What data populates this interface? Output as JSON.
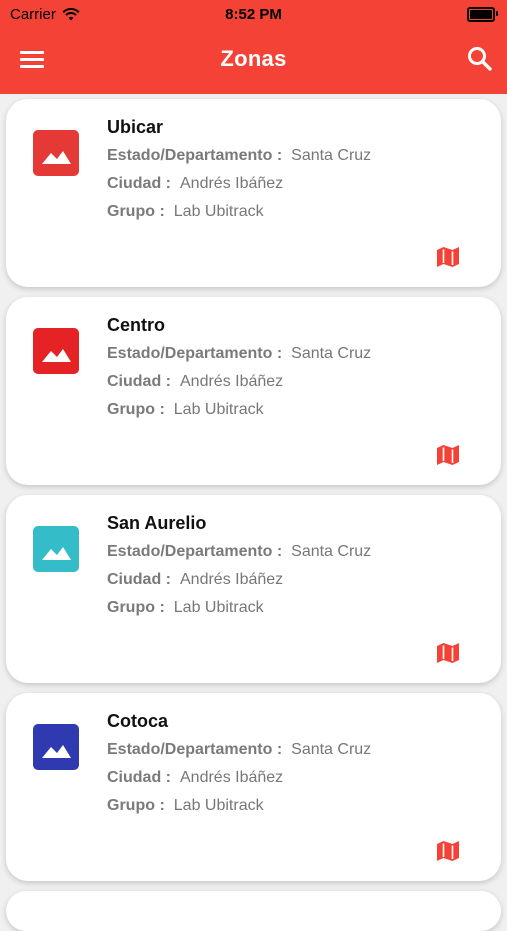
{
  "status_bar": {
    "carrier": "Carrier",
    "time": "8:52 PM"
  },
  "appbar": {
    "title": "Zonas",
    "menu_icon": "menu-icon",
    "search_icon": "search-icon"
  },
  "labels": {
    "estado": "Estado/Departamento :",
    "ciudad": "Ciudad :",
    "grupo": "Grupo :"
  },
  "zones": [
    {
      "name": "Ubicar",
      "estado": "Santa Cruz",
      "ciudad": "Andrés Ibáñez",
      "grupo": "Lab Ubitrack",
      "color": "#e53935"
    },
    {
      "name": "Centro",
      "estado": "Santa Cruz",
      "ciudad": "Andrés Ibáñez",
      "grupo": "Lab Ubitrack",
      "color": "#e52224"
    },
    {
      "name": "San Aurelio",
      "estado": "Santa Cruz",
      "ciudad": "Andrés Ibáñez",
      "grupo": "Lab Ubitrack",
      "color": "#35bcc9"
    },
    {
      "name": "Cotoca",
      "estado": "Santa Cruz",
      "ciudad": "Andrés Ibáñez",
      "grupo": "Lab Ubitrack",
      "color": "#2f3ab0"
    }
  ],
  "colors": {
    "primary": "#f44336",
    "map_icon": "#f44336"
  }
}
